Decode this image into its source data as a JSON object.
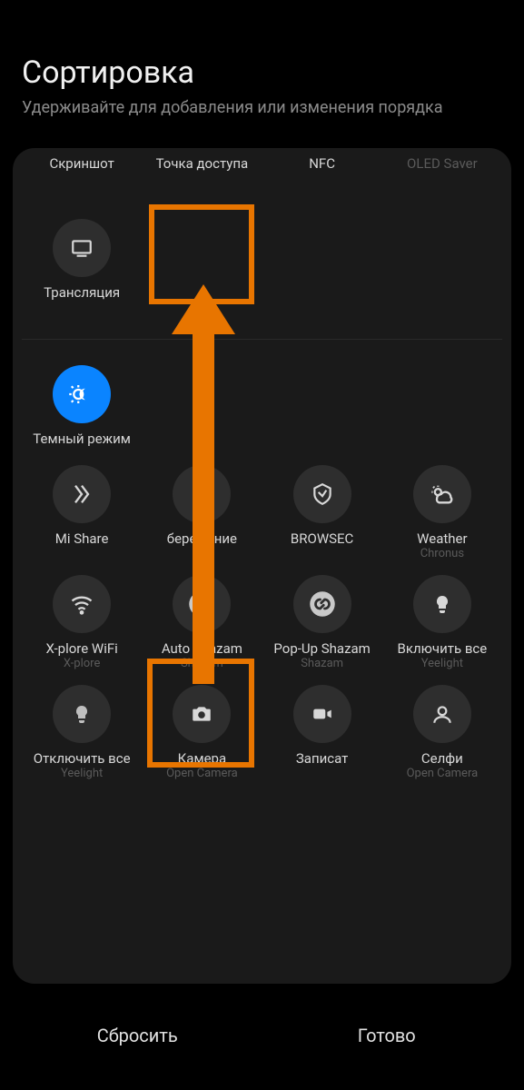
{
  "header": {
    "title": "Сортировка",
    "subtitle": "Удерживайте для добавления или изменения порядка"
  },
  "top_row1": [
    {
      "label": "Скриншот",
      "icon": "screenshot",
      "active": false,
      "dim": false
    },
    {
      "label": "Точка доступа",
      "icon": "hotspot",
      "active": false,
      "dim": false
    },
    {
      "label": "NFC",
      "icon": "nfc",
      "active": true,
      "dim": false
    },
    {
      "label": "OLED Saver",
      "icon": "oled",
      "active": false,
      "dim": true
    }
  ],
  "top_row2": [
    {
      "label": "Трансляция",
      "icon": "cast",
      "active": false,
      "dim": false
    }
  ],
  "bottom_row1": [
    {
      "label": "Темный режим",
      "icon": "darkmode",
      "active": true,
      "dim": false
    }
  ],
  "bottom_row2": [
    {
      "label": "Mi Share",
      "sub": "",
      "icon": "mishare"
    },
    {
      "label": "бережение",
      "sub": "",
      "icon": "power"
    },
    {
      "label": "BROWSEC",
      "sub": "",
      "icon": "browsec"
    },
    {
      "label": "Weather",
      "sub": "Chronus",
      "icon": "weather"
    }
  ],
  "bottom_row3": [
    {
      "label": "X-plore WiFi",
      "sub": "X-plore",
      "icon": "wifi"
    },
    {
      "label": "Auto Shazam",
      "sub": "Shazam",
      "icon": "shazam"
    },
    {
      "label": "Pop-Up Shazam",
      "sub": "Shazam",
      "icon": "shazam"
    },
    {
      "label": "Включить все",
      "sub": "Yeelight",
      "icon": "bulb"
    }
  ],
  "bottom_row4": [
    {
      "label": "Отключить все",
      "sub": "Yeelight",
      "icon": "bulb-off"
    },
    {
      "label": "Камера",
      "sub": "Open Camera",
      "icon": "camera"
    },
    {
      "label": "Записат",
      "sub": "",
      "icon": "video"
    },
    {
      "label": "Селфи",
      "sub": "Open Camera",
      "icon": "selfie"
    }
  ],
  "footer": {
    "reset": "Сбросить",
    "done": "Готово"
  }
}
